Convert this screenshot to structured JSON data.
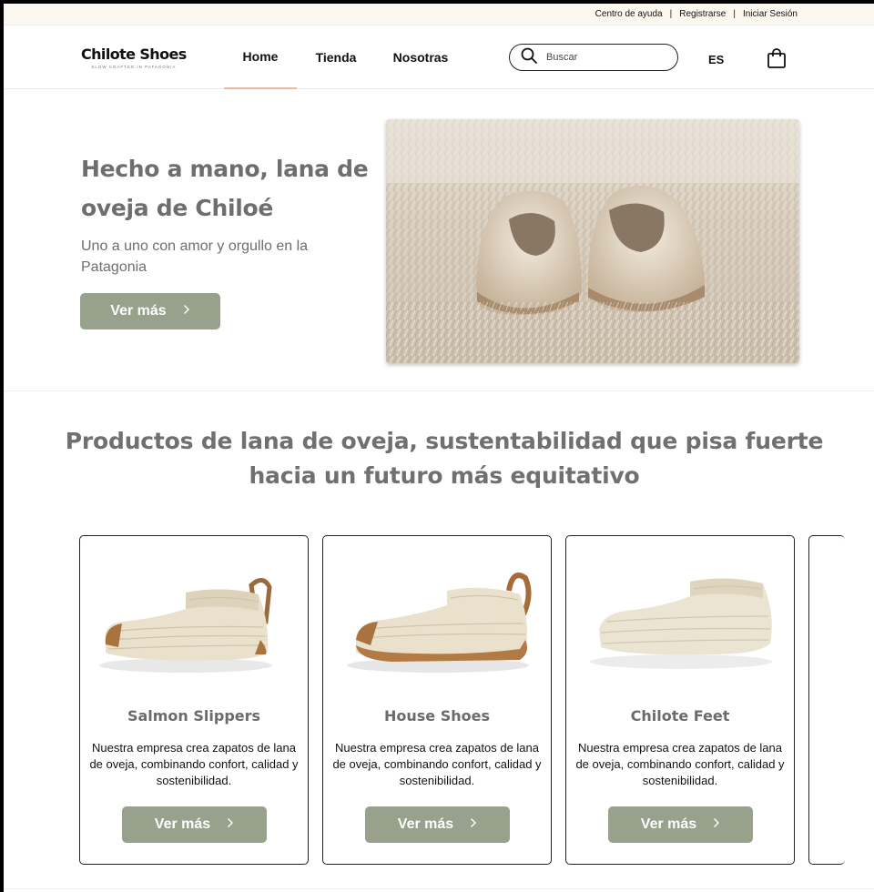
{
  "utility": {
    "help": "Centro de ayuda",
    "register": "Registrarse",
    "login": "Iniciar Sesión",
    "separator": "|"
  },
  "brand": {
    "name": "Chilote Shoes",
    "tagline": "SLOW CRAFTED IN PATAGONIA"
  },
  "nav": {
    "items": [
      {
        "label": "Home",
        "active": true
      },
      {
        "label": "Tienda",
        "active": false
      },
      {
        "label": "Nosotras",
        "active": false
      }
    ]
  },
  "search": {
    "placeholder": "Buscar"
  },
  "language": "ES",
  "icons": {
    "search": "search-icon",
    "cart": "shopping-bag-icon",
    "chevron": "chevron-right-icon"
  },
  "hero": {
    "title": "Hecho a mano, lana de oveja de Chiloé",
    "subtitle": "Uno a uno con amor y orgullo en la Patagonia",
    "button": "Ver más",
    "image_alt": "Pantuflas de lana sobre alfombra peluda"
  },
  "section": {
    "title": "Productos de lana de oveja, sustentabilidad que pisa fuerte hacia un futuro más equitativo"
  },
  "products": [
    {
      "name": "Salmon Slippers",
      "description": "Nuestra empresa crea zapatos de lana de oveja, combinando confort, calidad y sostenibilidad.",
      "button": "Ver más"
    },
    {
      "name": "House Shoes",
      "description": "Nuestra empresa crea zapatos de lana de oveja, combinando confort, calidad y sostenibilidad.",
      "button": "Ver más"
    },
    {
      "name": "Chilote Feet",
      "description": "Nuestra empresa crea zapatos de lana de oveja, combinando confort, calidad y sostenibilidad.",
      "button": "Ver más"
    }
  ],
  "colors": {
    "accent_button": "#98a18b",
    "nav_underline": "#e9b9a2",
    "utility_bg": "#fdf7f2",
    "heading_gray": "#6e6e6e"
  }
}
